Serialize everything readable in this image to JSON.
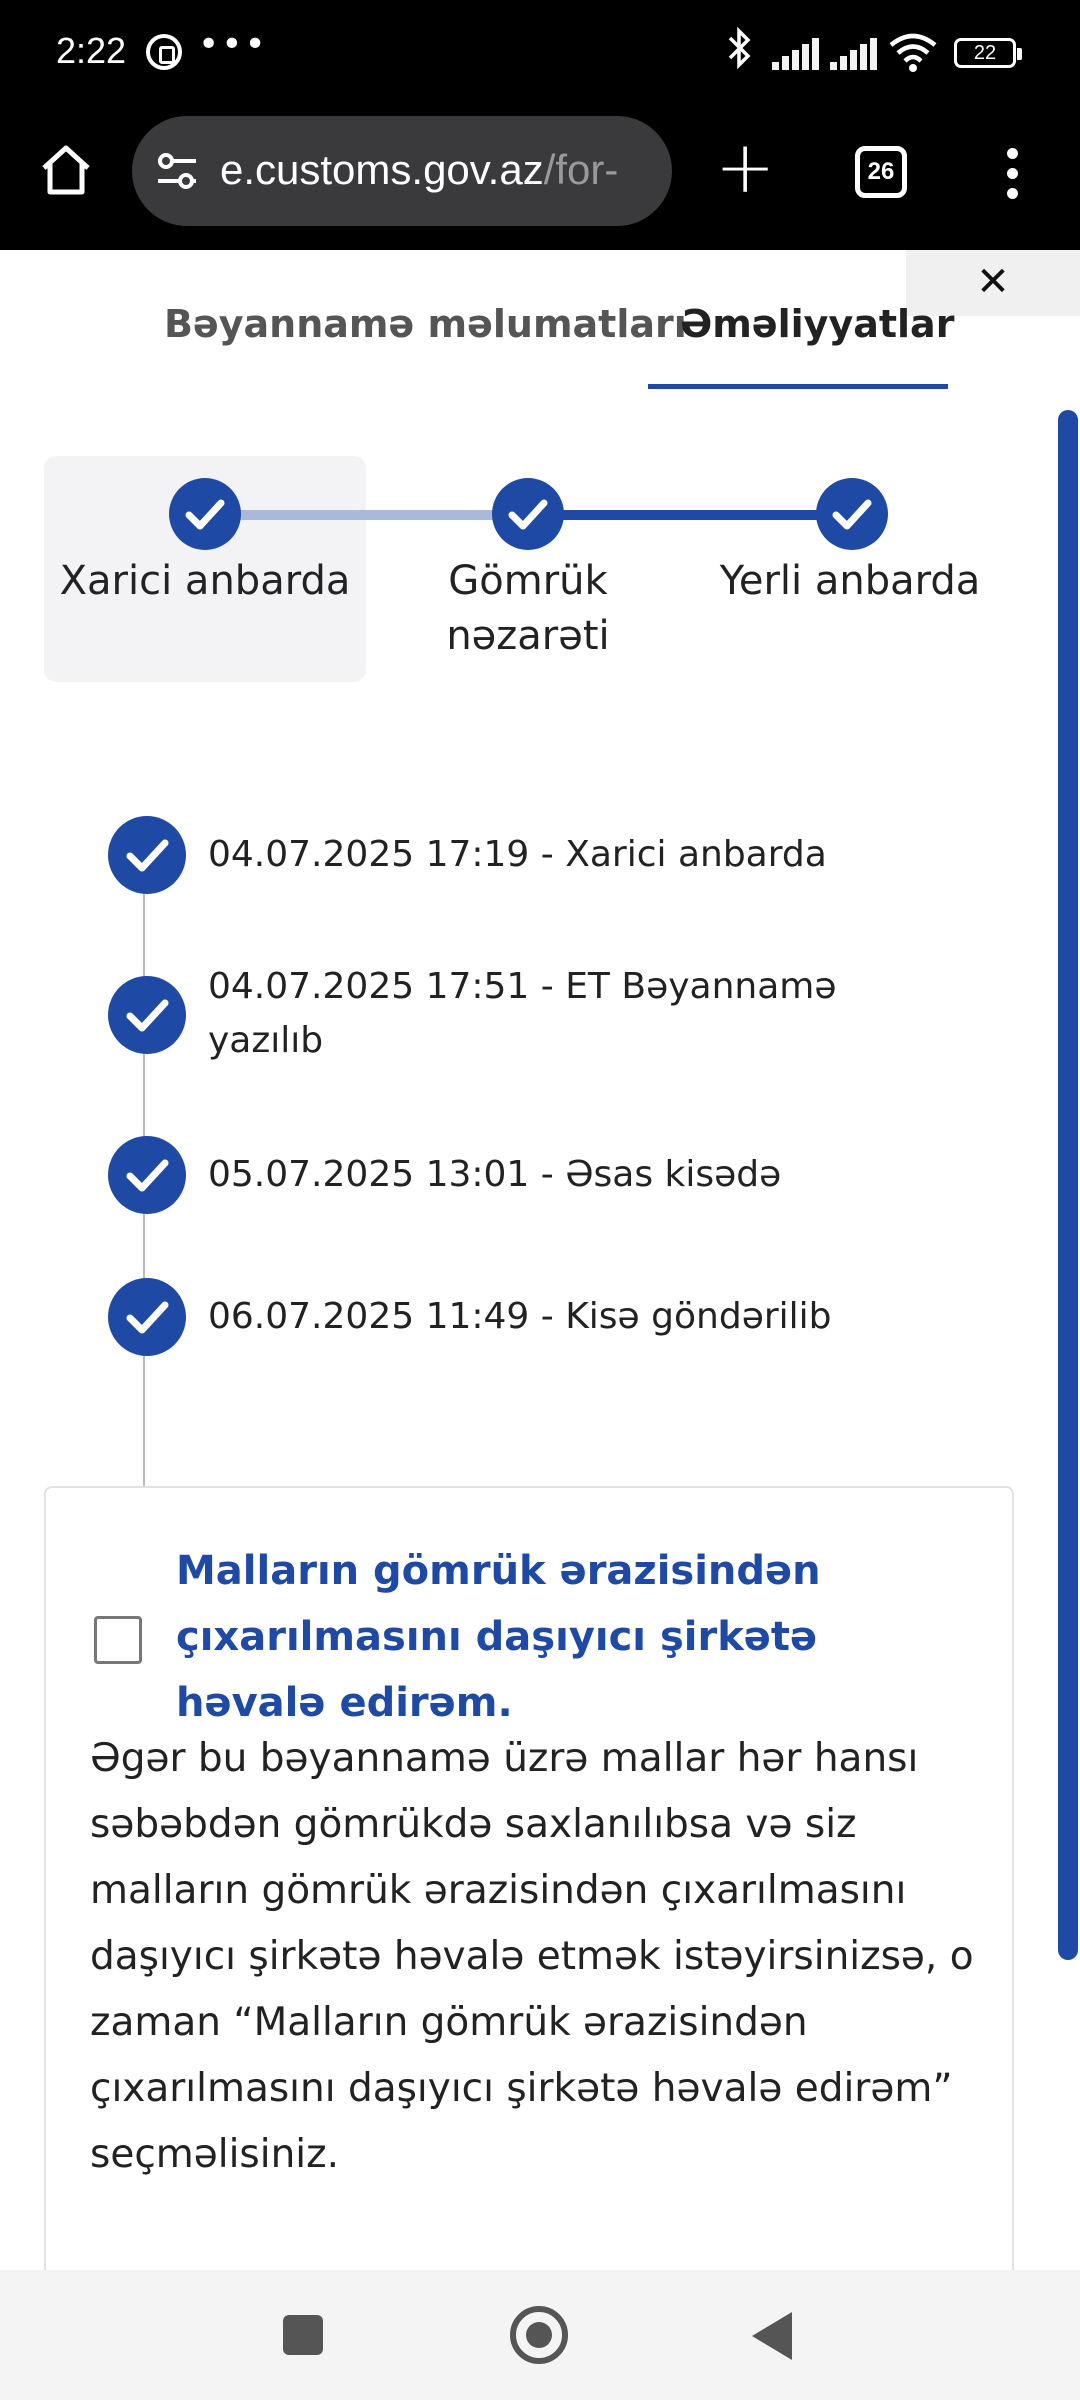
{
  "status_bar": {
    "time": "2:22",
    "notification_icons": [
      "whatsapp-icon",
      "more-dots-icon"
    ],
    "dots": "•••",
    "system_icons": [
      "bluetooth-icon",
      "signal-icon",
      "signal-icon",
      "wifi-icon",
      "battery-icon"
    ],
    "battery": "22"
  },
  "browser": {
    "url_main": "e.customs.gov.az",
    "url_dim": "/for-",
    "tab_count": "26",
    "plus": "+"
  },
  "page": {
    "close_label": "✕",
    "tabs": [
      {
        "label": "Bəyannamə məlumatları",
        "active": false
      },
      {
        "label": "Əməliyyatlar",
        "active": true
      }
    ],
    "stepper": [
      {
        "label": "Xarici anbarda",
        "done": true
      },
      {
        "label": "Gömrük nəzarəti",
        "done": true
      },
      {
        "label": "Yerli anbarda",
        "done": true
      }
    ],
    "timeline": [
      {
        "text": "04.07.2025 17:19 - Xarici anbarda"
      },
      {
        "text": "04.07.2025 17:51 - ET Bəyannamə yazılıb"
      },
      {
        "text": "05.07.2025 13:01 - Əsas kisədə"
      },
      {
        "text": "06.07.2025 11:49 - Kisə göndərilib"
      }
    ],
    "card": {
      "checkbox_checked": false,
      "title": "Malların gömrük ərazisindən çıxarılmasını daşıyıcı şirkətə həvalə edirəm.",
      "body": "Əgər bu bəyannamə üzrə mallar hər hansı səbəbdən gömrükdə saxlanılıbsa və siz malların gömrük ərazisindən çıxarılmasını daşıyıcı şirkətə həvalə etmək istəyirsinizsə, o zaman “Malların gömrük ərazisindən çıxarılmasını daşıyıcı şirkətə həvalə edirəm” seçməlisiniz."
    }
  },
  "colors": {
    "accent": "#1e4aa5",
    "accent_light": "#a8b9dc",
    "stepper_bg": "#f3f3f5"
  },
  "nav_bar": {
    "buttons": [
      "recent-apps-icon",
      "home-icon",
      "back-icon"
    ]
  }
}
